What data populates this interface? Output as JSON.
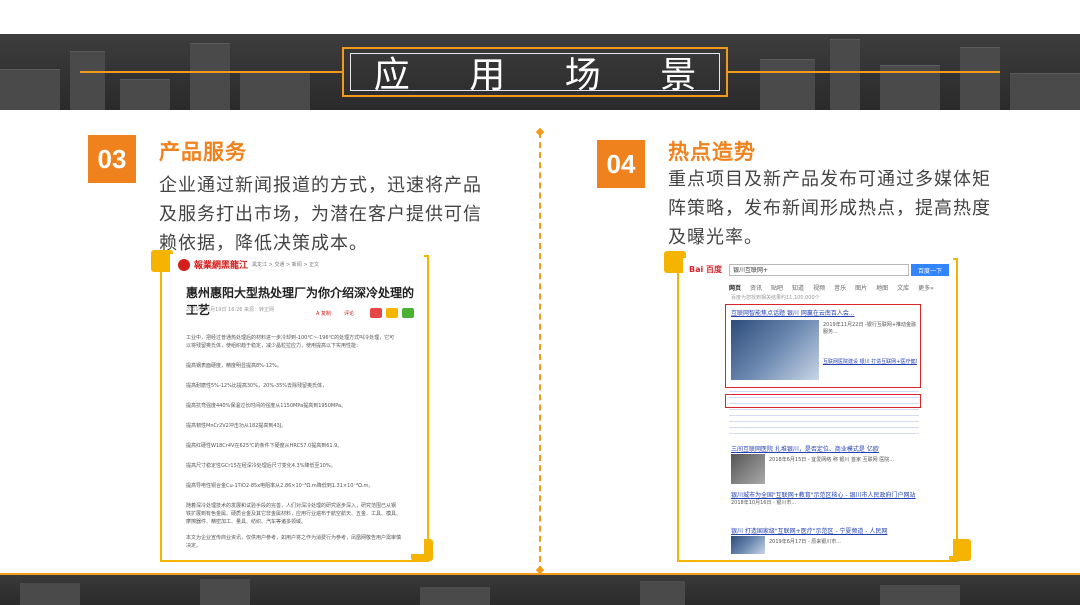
{
  "header": {
    "title_chars": [
      "应",
      "用",
      "场",
      "景"
    ]
  },
  "sections": [
    {
      "number": "03",
      "title": "产品服务",
      "desc_lines": [
        "企业通过新闻报道的方式，迅速将产品",
        "及服务打出市场，为潜在客户提供可信",
        "赖依据，降低决策成本。"
      ]
    },
    {
      "number": "04",
      "title": "热点造势",
      "desc_lines": [
        "重点项目及新产品发布可通过多媒体矩",
        "阵策略，发布新闻形成热点，提高热度",
        "及曝光率。"
      ]
    }
  ],
  "article": {
    "site": "報業網黑龍江",
    "breadcrumb": "黑龙江 > 交通 > 新闻 > 正文",
    "headline": "惠州惠阳大型热处理厂为你介绍深冷处理的工艺",
    "meta": "2019年10月19日 16:26    来源：转正网",
    "share_labels": [
      "A 复制",
      "评论"
    ],
    "lines": [
      "工业中，把经过普通热处理后的材料进一步冷却到-100℃~-196℃的处理方式叫冷处理，它可",
      "以将残留奥氏体，使组织趋于稳定，减少晶粒拉应力，使用提高以下实用性能：",
      "提高钢表面硬度，精度明显提高8%-12%。",
      "提高耐磨性5%-12%比提高30%，20%-35%去除残留奥氏体，",
      "提高抗弯强度440%保温过长时间的强度从1150MPa提高到1950MPa。",
      "提高韧性MnCr2V2冲击功从182提高到43J。",
      "提高红硬性W18Cr4V在625℃的条件下硬度从HRC57.0提高到61.9。",
      "提高尺寸稳定性GCr15在经深冷处理后尺寸变化4.3%降低至10%。",
      "提高导电性铜合金Cu-1TiO2-85x电阻率从2.86×10⁻⁸Ω.m降低到1.31×10⁻⁸Ω.m。",
      "随着深冷处理技术的发展和试验手段的完善，人们对深冷处理的研究逐步深入，研究范围已从钢",
      "铁扩展到有色金属、硬质合金及其它非金属材料，应用行业遍布于航空航天、五金、工具、模具、",
      "摩擦器件、精密加工、量具、纺织、汽车等诸多领域。",
      "本文为企业宣传商业资讯，仅供用户参考，如用户将之作为消费行为参考，凤凰网敬告用户需审慎",
      "决定。"
    ]
  },
  "baidu": {
    "logo": "Bai 百度",
    "query": "银川互联网+",
    "search_btn": "百度一下",
    "tabs": [
      "网页",
      "资讯",
      "贴吧",
      "知道",
      "视频",
      "音乐",
      "图片",
      "地图",
      "文库",
      "更多»"
    ],
    "result_count": "百度为您找到相关结果约11,100,000个",
    "results": [
      {
        "title": "互联网智能焦点话题 银川 网赢在云南百人会...",
        "desc": "2019年11月22日 -银行互联网+推动金融服务..."
      },
      {
        "title": "互联网医院建设 银川 打造互联网+医疗健康示范区",
        "desc": "银川互联网医院..."
      },
      {
        "title": "三间互联网医院 扎堆银川，是否定位、商业模式是 亿欧",
        "desc": "2018年6月15日 - 宜爱网络 称 银川 首家 互联网 医院..."
      },
      {
        "title": "银川城市为全国\"互联网+教育\"示范区核心 - 银川市人民政府门户网站",
        "desc": "2018年10月16日 - 银川市..."
      },
      {
        "title": "银川 打造国家级\"互联网+医疗\"示范区 - 宁夏频道 - 人民网",
        "desc": "2019年6月17日 - 原来银川市..."
      }
    ]
  },
  "colors": {
    "accent": "#f0821e",
    "frame": "#f5b400",
    "band": "#2e2e2e",
    "highlight_box": "#d9252b"
  }
}
